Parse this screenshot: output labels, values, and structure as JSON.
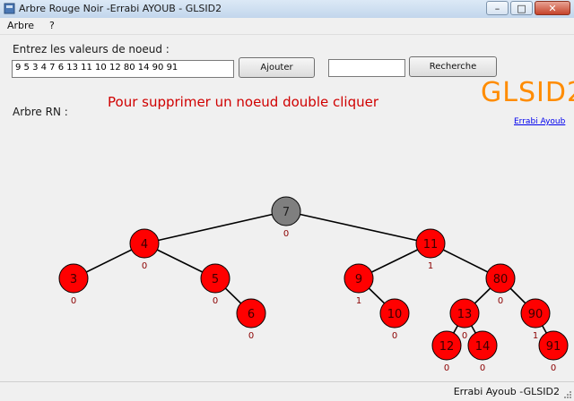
{
  "window": {
    "title": "Arbre Rouge Noir -Errabi AYOUB - GLSID2"
  },
  "menu": {
    "items": [
      "Arbre",
      "?"
    ]
  },
  "form": {
    "prompt_label": "Entrez les valeurs de noeud  :",
    "values_input": "9 5 3 4 7 6 13 11 10 12 80 14 90 91",
    "add_button": "Ajouter",
    "search_input": "",
    "search_button": "Recherche",
    "tree_label": "Arbre RN :",
    "delete_hint": "Pour supprimer un noeud double cliquer",
    "brand": "GLSID2",
    "author_link": "Errabi Ayoub"
  },
  "tree": {
    "colors": {
      "red": "#ff0000",
      "black": "#7f7f7f",
      "edge": "#000000",
      "height_label": "#8b0000"
    },
    "nodes": [
      {
        "id": "7",
        "value": "7",
        "color": "black",
        "height": "0"
      },
      {
        "id": "4",
        "value": "4",
        "color": "red",
        "height": "0"
      },
      {
        "id": "11",
        "value": "11",
        "color": "red",
        "height": "1"
      },
      {
        "id": "3",
        "value": "3",
        "color": "red",
        "height": "0"
      },
      {
        "id": "5",
        "value": "5",
        "color": "red",
        "height": "0"
      },
      {
        "id": "6",
        "value": "6",
        "color": "red",
        "height": "0"
      },
      {
        "id": "9",
        "value": "9",
        "color": "red",
        "height": "1"
      },
      {
        "id": "10",
        "value": "10",
        "color": "red",
        "height": "0"
      },
      {
        "id": "80",
        "value": "80",
        "color": "red",
        "height": "0"
      },
      {
        "id": "13",
        "value": "13",
        "color": "red",
        "height": "0"
      },
      {
        "id": "90",
        "value": "90",
        "color": "red",
        "height": "1"
      },
      {
        "id": "12",
        "value": "12",
        "color": "red",
        "height": "0"
      },
      {
        "id": "14",
        "value": "14",
        "color": "red",
        "height": "0"
      },
      {
        "id": "91",
        "value": "91",
        "color": "red",
        "height": "0"
      }
    ],
    "edges": [
      [
        "7",
        "4"
      ],
      [
        "7",
        "11"
      ],
      [
        "4",
        "3"
      ],
      [
        "4",
        "5"
      ],
      [
        "5",
        "6"
      ],
      [
        "11",
        "9"
      ],
      [
        "11",
        "80"
      ],
      [
        "9",
        "10"
      ],
      [
        "80",
        "13"
      ],
      [
        "80",
        "90"
      ],
      [
        "13",
        "12"
      ],
      [
        "13",
        "14"
      ],
      [
        "90",
        "91"
      ]
    ]
  },
  "statusbar": {
    "text": "Errabi Ayoub -GLSID2"
  }
}
